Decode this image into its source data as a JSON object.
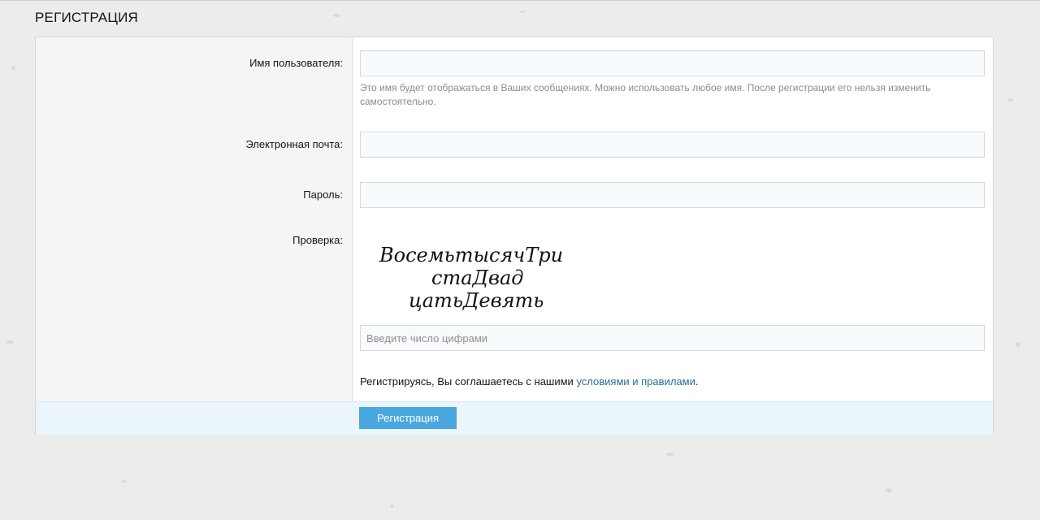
{
  "page": {
    "title": "РЕГИСТРАЦИЯ"
  },
  "form": {
    "username": {
      "label": "Имя пользователя:",
      "value": "",
      "hint": "Это имя будет отображаться в Ваших сообщениях. Можно использовать любое имя. После регистрации его нельзя изменить самостоятельно."
    },
    "email": {
      "label": "Электронная почта:",
      "value": ""
    },
    "password": {
      "label": "Пароль:",
      "value": ""
    },
    "captcha": {
      "label": "Проверка:",
      "text_lines": [
        "ВосемьтысячТри",
        "стаДвад",
        "цатьДевять"
      ],
      "placeholder": "Введите число цифрами",
      "value": ""
    },
    "terms": {
      "prefix": "Регистрируясь, Вы соглашаетесь с нашими ",
      "link": "условиями и правилами",
      "suffix": "."
    },
    "submit_label": "Регистрация"
  },
  "colors": {
    "accent": "#4aa7e0",
    "link": "#2b6b91",
    "footer_bg": "#eaf5fc"
  }
}
